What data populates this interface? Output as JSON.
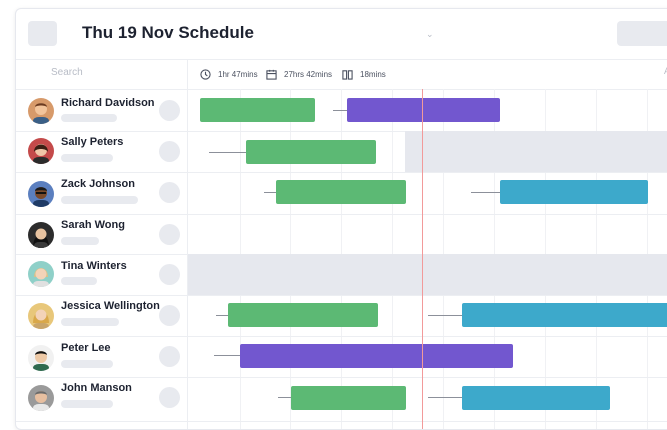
{
  "header": {
    "title": "Thu 19 Nov Schedule",
    "dropdown_icon": "chevron-down-icon"
  },
  "toolbar": {
    "search_placeholder": "Search",
    "stats": [
      {
        "icon": "clock-icon",
        "text": "1hr 47mins"
      },
      {
        "icon": "calendar-icon",
        "text": "27hrs 42mins"
      },
      {
        "icon": "book-icon",
        "text": "18mins"
      }
    ],
    "right_letter": "A"
  },
  "colors": {
    "green": "#5cb974",
    "purple": "#7257cf",
    "blue": "#3da9cb",
    "now_line": "#f29a9a",
    "unavailable": "#e6e8ee"
  },
  "staff": [
    {
      "name": "Richard Davidson"
    },
    {
      "name": "Sally Peters"
    },
    {
      "name": "Zack Johnson"
    },
    {
      "name": "Sarah Wong"
    },
    {
      "name": "Tina Winters"
    },
    {
      "name": "Jessica Wellington"
    },
    {
      "name": "Peter Lee"
    },
    {
      "name": "John Manson"
    }
  ]
}
